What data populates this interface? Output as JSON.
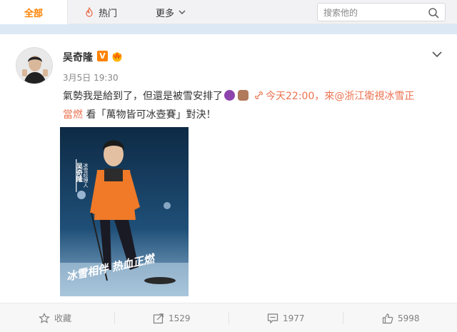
{
  "nav": {
    "tabs": [
      {
        "label": "全部",
        "active": true
      },
      {
        "label": "热门",
        "icon": "flame-icon"
      },
      {
        "label": "更多",
        "icon": "chevron-down-icon"
      }
    ],
    "search_placeholder": "搜索他的"
  },
  "post": {
    "author": "吴奇隆",
    "verified_badge": "V",
    "timestamp": "3月5日 19:30",
    "text_main": "氣勢我是給到了，但還是被雪安排了",
    "link_text_1": "今天22:00，來@浙江衛視冰雪正",
    "link_text_2": "當燃",
    "text_tail": " 看「萬物皆可冰壺賽」對決！",
    "poster_caption": [
      "冰雪经理人",
      "吴奇隆"
    ],
    "poster_brush_text": "冰雪相伴 热血正燃"
  },
  "actions": [
    {
      "label": "收藏",
      "icon": "star-icon"
    },
    {
      "label": "1529",
      "icon": "forward-icon"
    },
    {
      "label": "1977",
      "icon": "comment-icon"
    },
    {
      "label": "5998",
      "icon": "thumbs-up-icon"
    }
  ],
  "colors": {
    "accent": "#ff8200",
    "link": "#eb7350",
    "band": "#dce9f5"
  }
}
